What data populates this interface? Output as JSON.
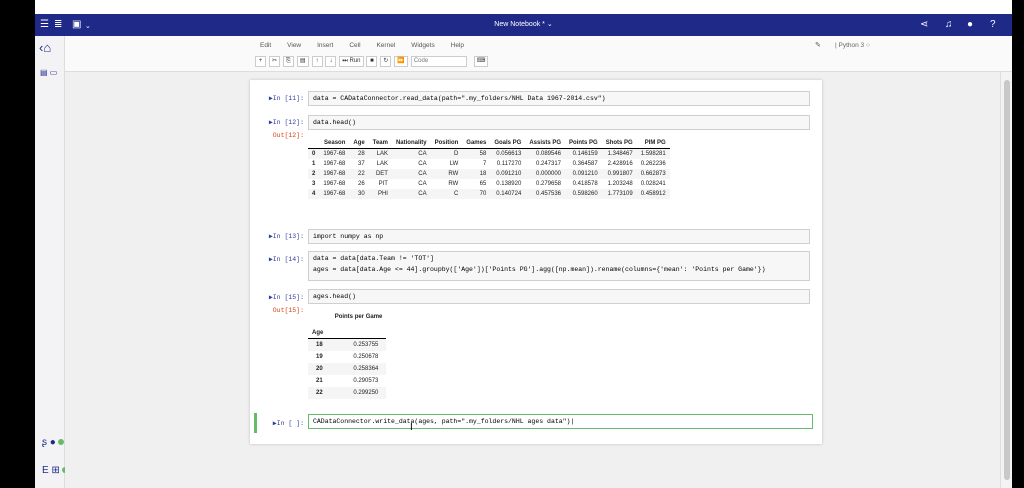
{
  "topbar": {
    "title": "New Notebook *"
  },
  "menu": [
    "Edit",
    "View",
    "Insert",
    "Cell",
    "Kernel",
    "Widgets",
    "Help"
  ],
  "kernel": "Python 3",
  "toolbar": {
    "run_label": "Run",
    "cell_type": "Code"
  },
  "cells": {
    "c11": {
      "prompt": "In [11]:",
      "code": "data = CADataConnector.read_data(path=\".my_folders/NHL Data 1967-2014.csv\")"
    },
    "c12": {
      "prompt": "In [12]:",
      "code": "data.head()",
      "out_prompt": "Out[12]:"
    },
    "c13": {
      "prompt": "In [13]:",
      "code": "import numpy as np"
    },
    "c14": {
      "prompt": "In [14]:",
      "code1": "data = data[data.Team != 'TOT']",
      "code2": "ages = data[data.Age <= 44].groupby(['Age'])['Points PG'].agg([np.mean]).rename(columns={'mean': 'Points per Game'})"
    },
    "c15": {
      "prompt": "In [15]:",
      "code": "ages.head()",
      "out_prompt": "Out[15]:"
    },
    "c16": {
      "prompt": "In [ ]:",
      "code": "CADataConnector.write_data(ages, path=\".my_folders/NHL ages data\")"
    }
  },
  "df1": {
    "columns": [
      "",
      "Season",
      "Age",
      "Team",
      "Nationality",
      "Position",
      "Games",
      "Goals PG",
      "Assists PG",
      "Points PG",
      "Shots PG",
      "PIM PG"
    ],
    "rows": [
      [
        "0",
        "1967-68",
        "28",
        "LAK",
        "CA",
        "D",
        "58",
        "0.056613",
        "0.089546",
        "0.146159",
        "1.348467",
        "1.598281"
      ],
      [
        "1",
        "1967-68",
        "37",
        "LAK",
        "CA",
        "LW",
        "7",
        "0.117270",
        "0.247317",
        "0.364587",
        "2.428916",
        "0.262236"
      ],
      [
        "2",
        "1967-68",
        "22",
        "DET",
        "CA",
        "RW",
        "18",
        "0.091210",
        "0.000000",
        "0.091210",
        "0.991807",
        "0.662873"
      ],
      [
        "3",
        "1967-68",
        "26",
        "PIT",
        "CA",
        "RW",
        "65",
        "0.138920",
        "0.279658",
        "0.418578",
        "1.203248",
        "0.028241"
      ],
      [
        "4",
        "1967-68",
        "30",
        "PHI",
        "CA",
        "C",
        "70",
        "0.140724",
        "0.457536",
        "0.598260",
        "1.773109",
        "0.458912"
      ]
    ]
  },
  "df2": {
    "column": "Points per Game",
    "index_name": "Age",
    "rows": [
      [
        "18",
        "0.253755"
      ],
      [
        "19",
        "0.250678"
      ],
      [
        "20",
        "0.258364"
      ],
      [
        "21",
        "0.290573"
      ],
      [
        "22",
        "0.299250"
      ]
    ]
  }
}
